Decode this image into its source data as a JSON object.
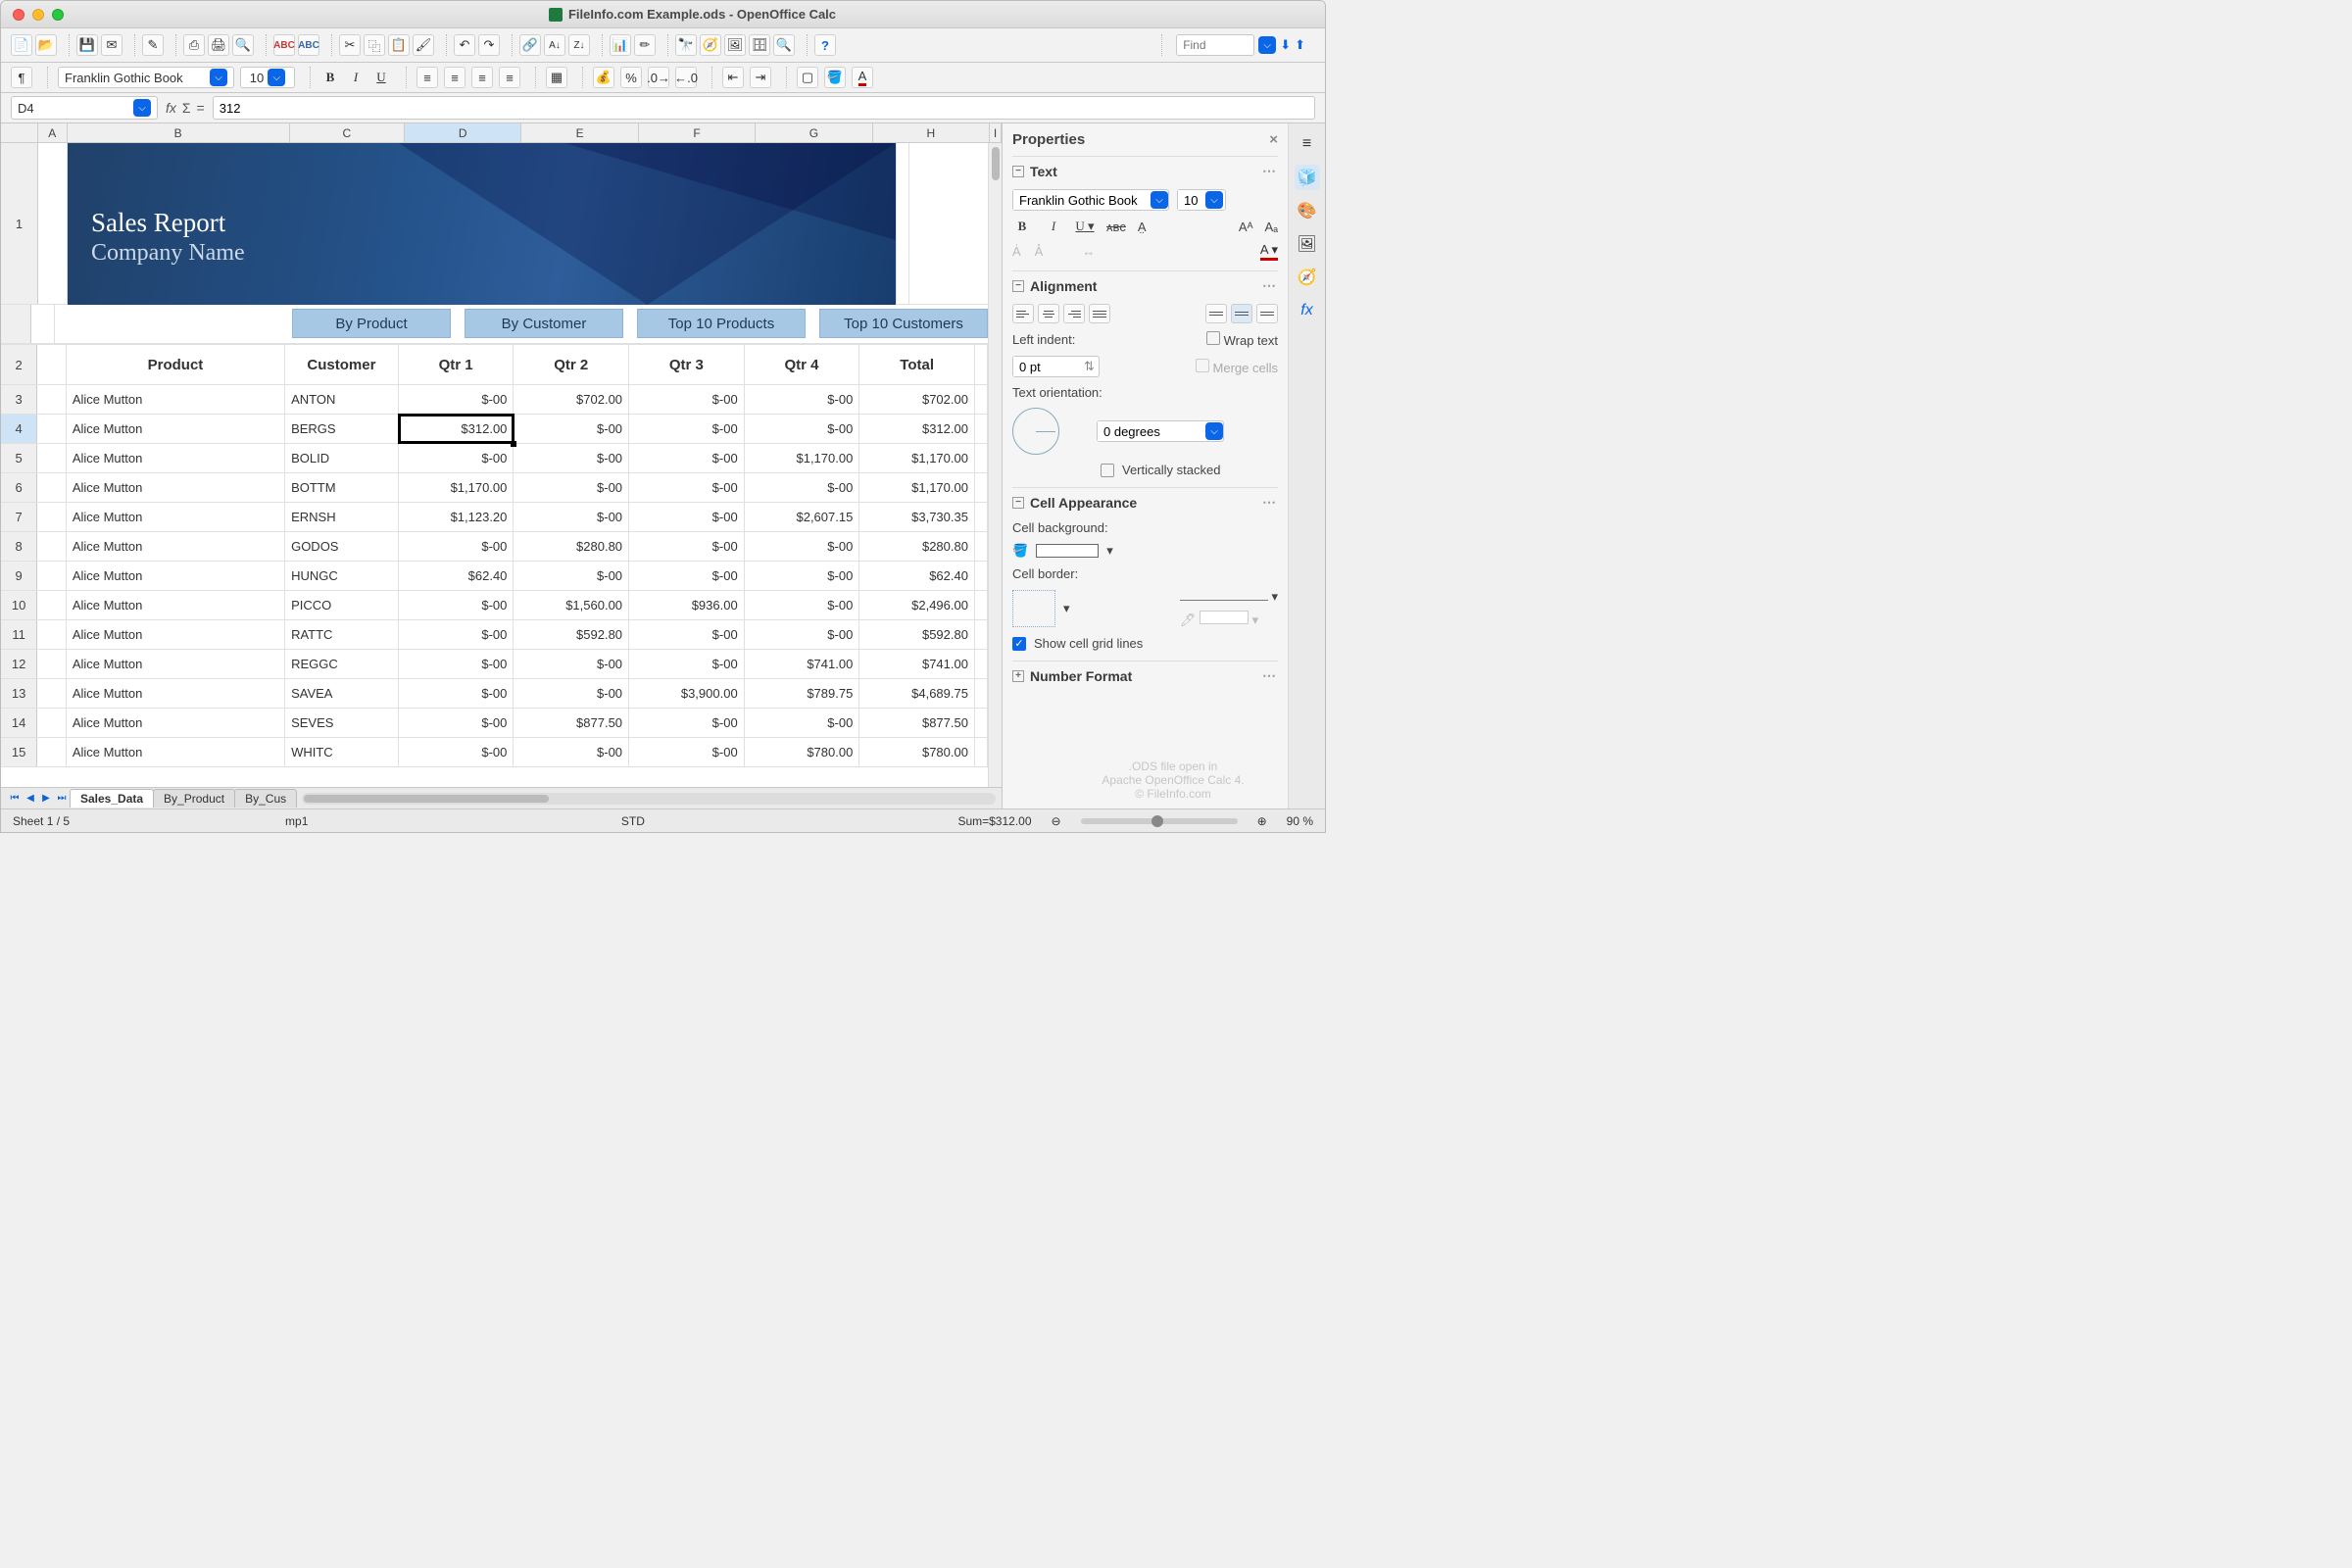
{
  "title": "FileInfo.com Example.ods - OpenOffice Calc",
  "toolbar": {
    "find_placeholder": "Find"
  },
  "formatbar": {
    "font": "Franklin Gothic Book",
    "size": "10"
  },
  "refbar": {
    "cell": "D4",
    "formula": "312"
  },
  "columns": [
    "A",
    "B",
    "C",
    "D",
    "E",
    "F",
    "G",
    "H",
    "I"
  ],
  "banner": {
    "title": "Sales Report",
    "subtitle": "Company Name"
  },
  "tabButtons": [
    "By Product",
    "By Customer",
    "Top 10 Products",
    "Top 10 Customers"
  ],
  "headers": [
    "Product",
    "Customer",
    "Qtr 1",
    "Qtr 2",
    "Qtr 3",
    "Qtr 4",
    "Total"
  ],
  "rows": [
    {
      "n": 3,
      "p": "Alice Mutton",
      "c": "ANTON",
      "q1": "$-00",
      "q2": "$702.00",
      "q3": "$-00",
      "q4": "$-00",
      "t": "$702.00"
    },
    {
      "n": 4,
      "p": "Alice Mutton",
      "c": "BERGS",
      "q1": "$312.00",
      "q2": "$-00",
      "q3": "$-00",
      "q4": "$-00",
      "t": "$312.00"
    },
    {
      "n": 5,
      "p": "Alice Mutton",
      "c": "BOLID",
      "q1": "$-00",
      "q2": "$-00",
      "q3": "$-00",
      "q4": "$1,170.00",
      "t": "$1,170.00"
    },
    {
      "n": 6,
      "p": "Alice Mutton",
      "c": "BOTTM",
      "q1": "$1,170.00",
      "q2": "$-00",
      "q3": "$-00",
      "q4": "$-00",
      "t": "$1,170.00"
    },
    {
      "n": 7,
      "p": "Alice Mutton",
      "c": "ERNSH",
      "q1": "$1,123.20",
      "q2": "$-00",
      "q3": "$-00",
      "q4": "$2,607.15",
      "t": "$3,730.35"
    },
    {
      "n": 8,
      "p": "Alice Mutton",
      "c": "GODOS",
      "q1": "$-00",
      "q2": "$280.80",
      "q3": "$-00",
      "q4": "$-00",
      "t": "$280.80"
    },
    {
      "n": 9,
      "p": "Alice Mutton",
      "c": "HUNGC",
      "q1": "$62.40",
      "q2": "$-00",
      "q3": "$-00",
      "q4": "$-00",
      "t": "$62.40"
    },
    {
      "n": 10,
      "p": "Alice Mutton",
      "c": "PICCO",
      "q1": "$-00",
      "q2": "$1,560.00",
      "q3": "$936.00",
      "q4": "$-00",
      "t": "$2,496.00"
    },
    {
      "n": 11,
      "p": "Alice Mutton",
      "c": "RATTC",
      "q1": "$-00",
      "q2": "$592.80",
      "q3": "$-00",
      "q4": "$-00",
      "t": "$592.80"
    },
    {
      "n": 12,
      "p": "Alice Mutton",
      "c": "REGGC",
      "q1": "$-00",
      "q2": "$-00",
      "q3": "$-00",
      "q4": "$741.00",
      "t": "$741.00"
    },
    {
      "n": 13,
      "p": "Alice Mutton",
      "c": "SAVEA",
      "q1": "$-00",
      "q2": "$-00",
      "q3": "$3,900.00",
      "q4": "$789.75",
      "t": "$4,689.75"
    },
    {
      "n": 14,
      "p": "Alice Mutton",
      "c": "SEVES",
      "q1": "$-00",
      "q2": "$877.50",
      "q3": "$-00",
      "q4": "$-00",
      "t": "$877.50"
    },
    {
      "n": 15,
      "p": "Alice Mutton",
      "c": "WHITC",
      "q1": "$-00",
      "q2": "$-00",
      "q3": "$-00",
      "q4": "$780.00",
      "t": "$780.00"
    }
  ],
  "sidebar": {
    "title": "Properties",
    "text": {
      "title": "Text",
      "font": "Franklin Gothic Book",
      "size": "10"
    },
    "alignment": {
      "title": "Alignment",
      "indentLabel": "Left indent:",
      "indentValue": "0 pt",
      "wrap": "Wrap text",
      "merge": "Merge cells",
      "orientLabel": "Text orientation:",
      "degrees": "0 degrees",
      "vstack": "Vertically stacked"
    },
    "appearance": {
      "title": "Cell Appearance",
      "bg": "Cell background:",
      "border": "Cell border:",
      "grid": "Show cell grid lines"
    },
    "numfmt": {
      "title": "Number Format"
    }
  },
  "sheetTabs": [
    "Sales_Data",
    "By_Product",
    "By_Cus"
  ],
  "status": {
    "sheet": "Sheet 1 / 5",
    "style": "mp1",
    "mode": "STD",
    "sum": "Sum=$312.00",
    "zoom": "90 %"
  },
  "watermark": {
    "l1": ".ODS file open in",
    "l2": "Apache OpenOffice Calc 4.",
    "l3": "© FileInfo.com"
  }
}
